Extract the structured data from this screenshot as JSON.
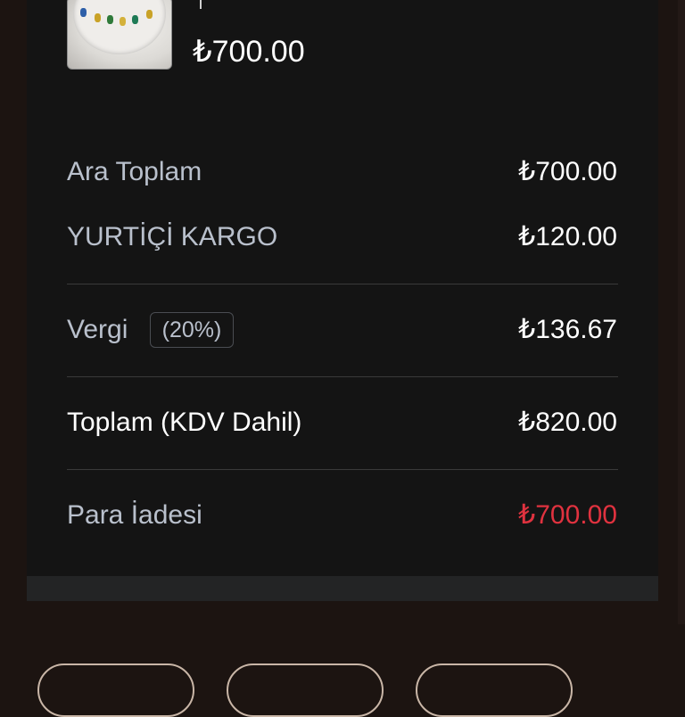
{
  "product": {
    "price": "₺700.00",
    "image_icon": "jewelry-product-photo"
  },
  "summary": {
    "subtotal_label": "Ara Toplam",
    "subtotal_value": "₺700.00",
    "shipping_label": "YURTİÇİ KARGO",
    "shipping_value": "₺120.00",
    "tax_label": "Vergi",
    "tax_rate": "(20%)",
    "tax_value": "₺136.67",
    "total_label": "Toplam (KDV Dahil)",
    "total_value": "₺820.00",
    "refund_label": "Para İadesi",
    "refund_value": "₺700.00"
  },
  "colors": {
    "background": "#1c1411",
    "card": "#141414",
    "refund_accent": "#e0323f",
    "pill_border": "#c9b6a7"
  }
}
